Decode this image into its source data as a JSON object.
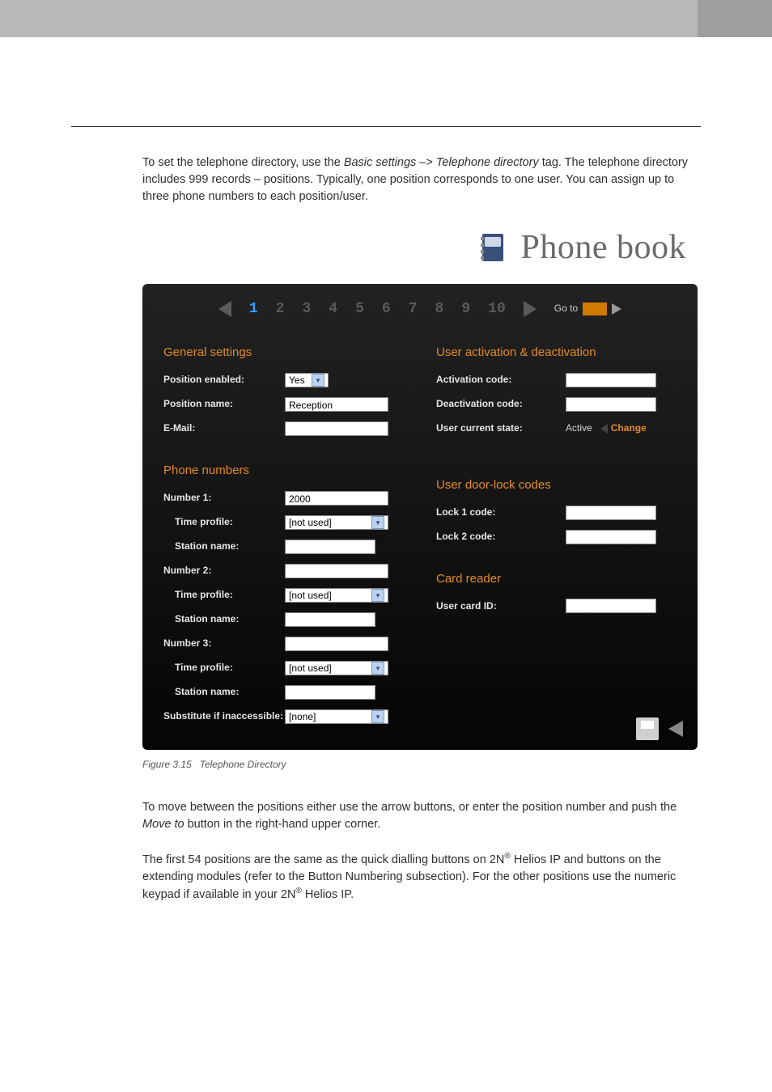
{
  "intro": {
    "p1_a": "To set the telephone directory, use the ",
    "p1_em1": "Basic settings",
    "p1_mid": " –> ",
    "p1_em2": "Telephone directory",
    "p1_b": " tag. The telephone directory includes 999 records – positions. Typically, one position corresponds to one user. You can assign up to three phone numbers to each position/user."
  },
  "shot": {
    "title": "Phone book",
    "pager": {
      "numbers": [
        "1",
        "2",
        "3",
        "4",
        "5",
        "6",
        "7",
        "8",
        "9",
        "10"
      ],
      "active_index": 0,
      "goto_label": "Go to"
    },
    "left": {
      "general_h": "General settings",
      "pos_enabled_label": "Position enabled:",
      "pos_enabled_value": "Yes",
      "pos_name_label": "Position name:",
      "pos_name_value": "Reception",
      "email_label": "E-Mail:",
      "email_value": "",
      "phones_h": "Phone numbers",
      "n1": {
        "num_label": "Number 1:",
        "num_value": "2000",
        "tp_label": "Time profile:",
        "tp_value": "[not used]",
        "st_label": "Station name:",
        "st_value": ""
      },
      "n2": {
        "num_label": "Number 2:",
        "num_value": "",
        "tp_label": "Time profile:",
        "tp_value": "[not used]",
        "st_label": "Station name:",
        "st_value": ""
      },
      "n3": {
        "num_label": "Number 3:",
        "num_value": "",
        "tp_label": "Time profile:",
        "tp_value": "[not used]",
        "st_label": "Station name:",
        "st_value": ""
      },
      "sub_label": "Substitute if inaccessible:",
      "sub_value": "[none]"
    },
    "right": {
      "activ_h": "User activation & deactivation",
      "act_code_label": "Activation code:",
      "act_code_value": "",
      "deact_code_label": "Deactivation code:",
      "deact_code_value": "",
      "state_label": "User current state:",
      "state_value": "Active",
      "change_label": "Change",
      "locks_h": "User door-lock codes",
      "lock1_label": "Lock 1 code:",
      "lock1_value": "",
      "lock2_label": "Lock 2 code:",
      "lock2_value": "",
      "reader_h": "Card reader",
      "card_label": "User card ID:",
      "card_value": ""
    }
  },
  "caption_a": "Figure 3.15",
  "caption_b": "Telephone Directory",
  "para2": {
    "a": "To move between the positions either use the arrow buttons, or enter the position number and push the ",
    "em": "Move to",
    "b": " button in the right-hand upper corner."
  },
  "para3": {
    "a": "The first 54 positions are the same as the quick dialling buttons on 2N",
    "b": " Helios IP and buttons on the extending modules (refer to the Button Numbering subsection). For the other positions use the numeric keypad if available in your 2N",
    "c": " Helios IP."
  }
}
